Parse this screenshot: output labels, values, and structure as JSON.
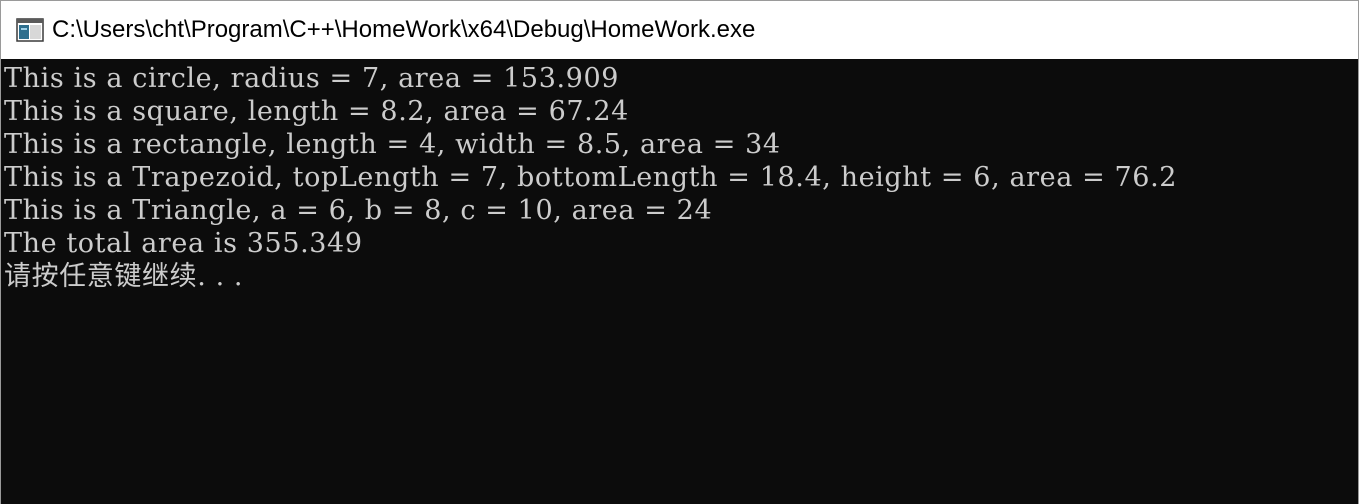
{
  "window": {
    "title": "C:\\Users\\cht\\Program\\C++\\HomeWork\\x64\\Debug\\HomeWork.exe",
    "icon": "console-app-icon"
  },
  "console": {
    "lines": [
      "This is a circle, radius = 7, area = 153.909",
      "This is a square, length = 8.2, area = 67.24",
      "This is a rectangle, length = 4, width = 8.5, area = 34",
      "This is a Trapezoid, topLength = 7, bottomLength = 18.4, height = 6, area = 76.2",
      "This is a Triangle, a = 6, b = 8, c = 10, area = 24",
      "The total area is 355.349",
      "请按任意键继续. . ."
    ],
    "text_color": "#cccccc",
    "background_color": "#0c0c0c"
  }
}
